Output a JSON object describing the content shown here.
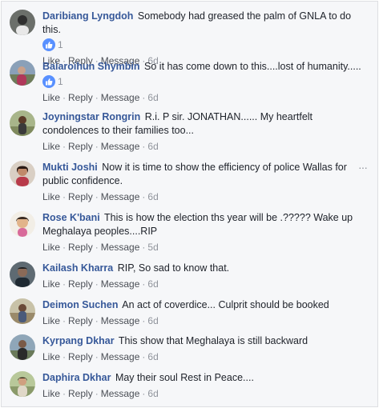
{
  "comments": [
    {
      "author": "Daribiang Lyngdoh",
      "text": "Somebody had greased the palm of GNLA to do this.",
      "reactions": "1",
      "like": "Like",
      "reply": "Reply",
      "message": "Message",
      "time": "6d"
    },
    {
      "author": "Baiaroihun Shymbin",
      "text": "So it has come down to this....lost of humanity.....",
      "reactions": "1",
      "like": "Like",
      "reply": "Reply",
      "message": "Message",
      "time": "6d"
    },
    {
      "author": "Joyningstar Rongrin",
      "text": "R.i. P sir. JONATHAN...... My heartfelt condolences to their families too...",
      "like": "Like",
      "reply": "Reply",
      "message": "Message",
      "time": "6d"
    },
    {
      "author": "Mukti Joshi",
      "text": "Now it is time to show the efficiency of police Wallas for public confidence.",
      "like": "Like",
      "reply": "Reply",
      "message": "Message",
      "time": "6d"
    },
    {
      "author": "Rose K'bani",
      "text": "This is how the election ths year will be .????? Wake up Meghalaya peoples....RIP",
      "like": "Like",
      "reply": "Reply",
      "message": "Message",
      "time": "5d"
    },
    {
      "author": "Kailash Kharra",
      "text": "RIP, So sad to know that.",
      "like": "Like",
      "reply": "Reply",
      "message": "Message",
      "time": "6d"
    },
    {
      "author": "Deimon Suchen",
      "text": "An act of coverdice... Culprit should be booked",
      "like": "Like",
      "reply": "Reply",
      "message": "Message",
      "time": "6d"
    },
    {
      "author": "Kyrpang Dkhar",
      "text": "This show that Meghalaya is still backward",
      "like": "Like",
      "reply": "Reply",
      "message": "Message",
      "time": "6d"
    },
    {
      "author": "Daphira Dkhar",
      "text": "May their soul Rest in Peace....",
      "like": "Like",
      "reply": "Reply",
      "message": "Message",
      "time": "6d"
    }
  ],
  "colors": {
    "author_link": "#365899",
    "meta_gray": "#90949c",
    "like_badge": "#5890ff",
    "background": "#f6f7f9"
  },
  "icons": {
    "like_reaction": "thumbs-up-icon",
    "options": "more-options-icon"
  }
}
